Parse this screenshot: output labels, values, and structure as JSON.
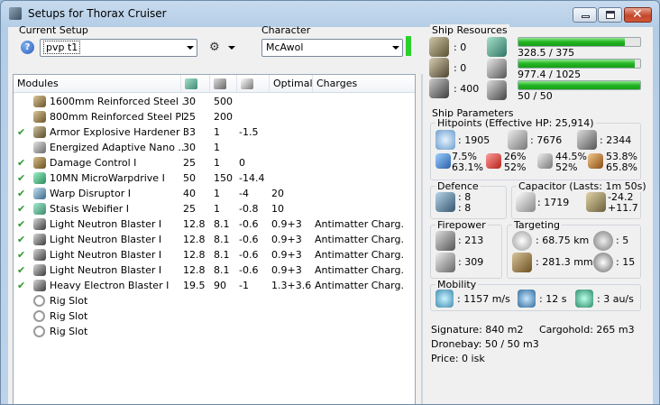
{
  "window": {
    "title": "Setups for Thorax Cruiser",
    "icon": "app-icon"
  },
  "colors": {
    "accent_green": "#2dcf2d",
    "list_bg": "#ffffff",
    "window_frame": "#b4cde6",
    "close_red": "#c4472c"
  },
  "setup": {
    "label": "Current Setup",
    "value": "pvp t1",
    "help_icon": "question-icon",
    "tools_icon": "gear-wrench-icon"
  },
  "character": {
    "label": "Character",
    "value": "McAwol"
  },
  "modules": {
    "headers": {
      "modules": "Modules",
      "optimal": "Optimal",
      "charges": "Charges"
    },
    "header_icons": [
      "cpu-icon",
      "powergrid-icon",
      "capacitor-icon"
    ],
    "rows": [
      {
        "check": "",
        "icon": "plate-icon",
        "name": "1600mm Reinforced Steel ...",
        "cpu": "30",
        "pg": "500",
        "cap": "",
        "optimal": "",
        "charges": ""
      },
      {
        "check": "",
        "icon": "plate-icon",
        "name": "800mm Reinforced Steel Pl...",
        "cpu": "25",
        "pg": "200",
        "cap": "",
        "optimal": "",
        "charges": ""
      },
      {
        "check": "✔",
        "icon": "hardener-icon",
        "name": "Armor Explosive Hardener I",
        "cpu": "33",
        "pg": "1",
        "cap": "-1.5",
        "optimal": "",
        "charges": ""
      },
      {
        "check": "",
        "icon": "membrane-icon",
        "name": "Energized Adaptive Nano ...",
        "cpu": "30",
        "pg": "1",
        "cap": "",
        "optimal": "",
        "charges": ""
      },
      {
        "check": "✔",
        "icon": "damage-control-icon",
        "name": "Damage Control I",
        "cpu": "25",
        "pg": "1",
        "cap": "0",
        "optimal": "",
        "charges": ""
      },
      {
        "check": "✔",
        "icon": "microwarpdrive-icon",
        "name": "10MN MicroWarpdrive I",
        "cpu": "50",
        "pg": "150",
        "cap": "-14.4",
        "optimal": "",
        "charges": ""
      },
      {
        "check": "✔",
        "icon": "disruptor-icon",
        "name": "Warp Disruptor I",
        "cpu": "40",
        "pg": "1",
        "cap": "-4",
        "optimal": "20",
        "charges": ""
      },
      {
        "check": "✔",
        "icon": "webifier-icon",
        "name": "Stasis Webifier I",
        "cpu": "25",
        "pg": "1",
        "cap": "-0.8",
        "optimal": "10",
        "charges": ""
      },
      {
        "check": "✔",
        "icon": "blaster-icon",
        "name": "Light Neutron Blaster I",
        "cpu": "12.8",
        "pg": "8.1",
        "cap": "-0.6",
        "optimal": "0.9+3",
        "charges": "Antimatter Charg..."
      },
      {
        "check": "✔",
        "icon": "blaster-icon",
        "name": "Light Neutron Blaster I",
        "cpu": "12.8",
        "pg": "8.1",
        "cap": "-0.6",
        "optimal": "0.9+3",
        "charges": "Antimatter Charg..."
      },
      {
        "check": "✔",
        "icon": "blaster-icon",
        "name": "Light Neutron Blaster I",
        "cpu": "12.8",
        "pg": "8.1",
        "cap": "-0.6",
        "optimal": "0.9+3",
        "charges": "Antimatter Charg..."
      },
      {
        "check": "✔",
        "icon": "blaster-icon",
        "name": "Light Neutron Blaster I",
        "cpu": "12.8",
        "pg": "8.1",
        "cap": "-0.6",
        "optimal": "0.9+3",
        "charges": "Antimatter Charg..."
      },
      {
        "check": "✔",
        "icon": "blaster-icon",
        "name": "Heavy Electron Blaster I",
        "cpu": "19.5",
        "pg": "90",
        "cap": "-1",
        "optimal": "1.3+3.6",
        "charges": "Antimatter Charg..."
      },
      {
        "check": "",
        "icon": "rig-slot-icon",
        "name": "Rig Slot",
        "cpu": "",
        "pg": "",
        "cap": "",
        "optimal": "",
        "charges": ""
      },
      {
        "check": "",
        "icon": "rig-slot-icon",
        "name": "Rig Slot",
        "cpu": "",
        "pg": "",
        "cap": "",
        "optimal": "",
        "charges": ""
      },
      {
        "check": "",
        "icon": "rig-slot-icon",
        "name": "Rig Slot",
        "cpu": "",
        "pg": "",
        "cap": "",
        "optimal": "",
        "charges": ""
      }
    ]
  },
  "resources": {
    "title": "Ship Resources",
    "turret": ": 0",
    "launcher": ": 0",
    "drone": ": 400",
    "cpu": {
      "text": "328.5 / 375",
      "fill": 0.876
    },
    "powergrid": {
      "text": "977.4 / 1025",
      "fill": 0.954
    },
    "calibration": {
      "text": "50 / 50",
      "fill": 1.0
    }
  },
  "params": {
    "title": "Ship Parameters",
    "hitpoints": {
      "title": "Hitpoints (Effective HP: 25,914)",
      "shield": ": 1905",
      "armor": ": 7676",
      "structure": ": 2344",
      "em": {
        "a": "7.5%",
        "b": "63.1%"
      },
      "thermal": {
        "a": "26%",
        "b": "52%"
      },
      "kinetic": {
        "a": "44.5%",
        "b": "52%"
      },
      "explosive": {
        "a": "53.8%",
        "b": "65.8%"
      }
    },
    "defence": {
      "title": "Defence",
      "a": ": 8",
      "b": ": 8"
    },
    "capacitor": {
      "title": "Capacitor (Lasts: 1m 50s)",
      "amount": ": 1719",
      "a": "-24.2",
      "b": "+11.7"
    },
    "firepower": {
      "title": "Firepower",
      "a": ": 213",
      "b": ": 309"
    },
    "targeting": {
      "title": "Targeting",
      "range": ": 68.75 km",
      "targets": ": 5",
      "sig": ": 281.3 mm",
      "scan": ": 15"
    },
    "mobility": {
      "title": "Mobility",
      "speed": ": 1157 m/s",
      "align": ": 12 s",
      "warp": ": 3 au/s"
    },
    "signature": "Signature: 840 m2",
    "cargohold": "Cargohold: 265 m3",
    "dronebay": "Dronebay: 50 / 50 m3",
    "price": "Price: 0 isk"
  }
}
